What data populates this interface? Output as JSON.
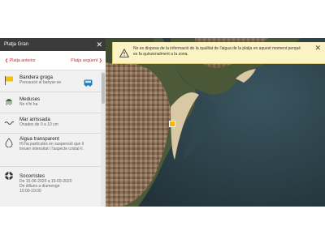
{
  "panel": {
    "title": "Platja Gran",
    "close_icon": "close-icon",
    "prev_label": "Platja anterior",
    "next_label": "Platja següent",
    "prev_glyph": "❮",
    "next_glyph": "❯"
  },
  "items": {
    "flag": {
      "title": "Bandera groga",
      "subtitle": "Precaució al banyar-se",
      "color": "#f2c200"
    },
    "jellyfish": {
      "title": "Meduses",
      "subtitle": "No n'hi ha"
    },
    "sea": {
      "title": "Mar arrissada",
      "subtitle": "Onades de 0 a 10 cm"
    },
    "water": {
      "title": "Aigua transparent",
      "line1": "Hi ha partícules en suspensió que li",
      "line2": "treuen intensitat i l'aspecte cristal·lí."
    },
    "rescue": {
      "title": "Socorristes",
      "line1": "De 15-06-2020 a 15-09-2020",
      "line2": "De dilluns a diumenge",
      "line3": "10:00-19:00"
    }
  },
  "alert": {
    "text": "No es disposa de la informació de la qualitat de l'aigua de la platja en aquest moment perquè es fa quinzenalment a la zona.",
    "background": "#fbf3c4",
    "close_glyph": "✕"
  },
  "colors": {
    "header": "#3b3b3b",
    "accent_red": "#d9232d",
    "panel_bg": "#f1f1f1"
  }
}
